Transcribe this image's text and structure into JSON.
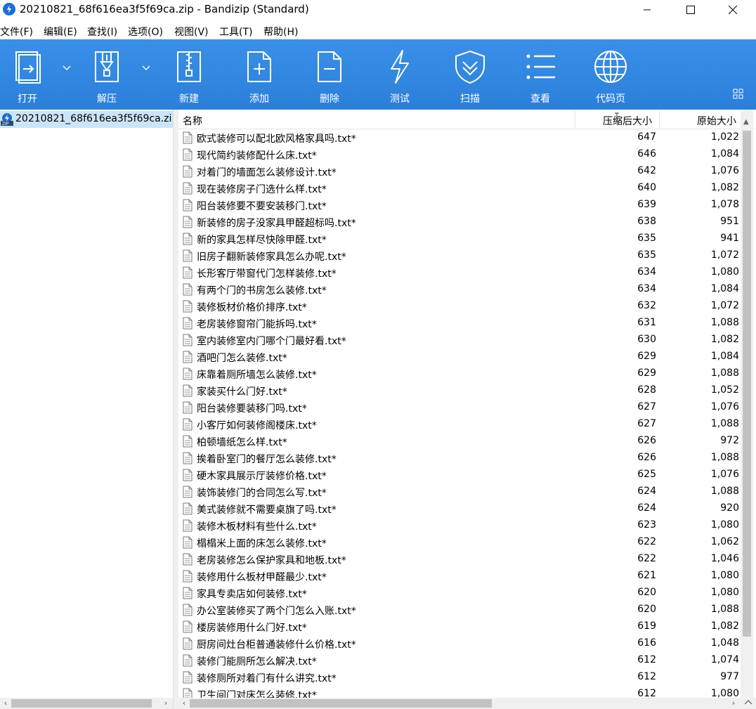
{
  "window": {
    "title": "20210821_68f616ea3f5f69ca.zip - Bandizip (Standard)"
  },
  "menu": [
    "文件(F)",
    "编辑(E)",
    "查找(I)",
    "选项(O)",
    "视图(V)",
    "工具(T)",
    "帮助(H)"
  ],
  "toolbar": {
    "open": "打开",
    "extract": "解压",
    "new": "新建",
    "add": "添加",
    "delete": "删除",
    "test": "测试",
    "scan": "扫描",
    "view": "查看",
    "codepage": "代码页"
  },
  "tree": {
    "archive": "20210821_68f616ea3f5f69ca.zi"
  },
  "columns": {
    "name": "名称",
    "compressed": "压缩后大小",
    "original": "原始大小"
  },
  "files": [
    {
      "name": "欧式装修可以配北欧风格家具吗.txt*",
      "compressed": "647",
      "original": "1,022"
    },
    {
      "name": "现代简约装修配什么床.txt*",
      "compressed": "646",
      "original": "1,084"
    },
    {
      "name": "对着门的墙面怎么装修设计.txt*",
      "compressed": "642",
      "original": "1,076"
    },
    {
      "name": "现在装修房子门选什么样.txt*",
      "compressed": "640",
      "original": "1,082"
    },
    {
      "name": "阳台装修要不要安装移门.txt*",
      "compressed": "639",
      "original": "1,078"
    },
    {
      "name": "新装修的房子没家具甲醛超标吗.txt*",
      "compressed": "638",
      "original": "951"
    },
    {
      "name": "新的家具怎样尽快除甲醛.txt*",
      "compressed": "635",
      "original": "941"
    },
    {
      "name": "旧房子翻新装修家具怎么办呢.txt*",
      "compressed": "635",
      "original": "1,072"
    },
    {
      "name": "长形客厅带窗代门怎样装修.txt*",
      "compressed": "634",
      "original": "1,080"
    },
    {
      "name": "有两个门的书房怎么装修.txt*",
      "compressed": "634",
      "original": "1,084"
    },
    {
      "name": "装修板材价格价排序.txt*",
      "compressed": "632",
      "original": "1,072"
    },
    {
      "name": "老房装修窗帘门能拆吗.txt*",
      "compressed": "631",
      "original": "1,088"
    },
    {
      "name": "室内装修室内门哪个门最好看.txt*",
      "compressed": "630",
      "original": "1,082"
    },
    {
      "name": "酒吧门怎么装修.txt*",
      "compressed": "629",
      "original": "1,084"
    },
    {
      "name": "床靠着厕所墙怎么装修.txt*",
      "compressed": "629",
      "original": "1,088"
    },
    {
      "name": "家装买什么门好.txt*",
      "compressed": "628",
      "original": "1,052"
    },
    {
      "name": "阳台装修要装移门吗.txt*",
      "compressed": "627",
      "original": "1,076"
    },
    {
      "name": "小客厅如何装修阁楼床.txt*",
      "compressed": "627",
      "original": "1,088"
    },
    {
      "name": "柏顿墙纸怎么样.txt*",
      "compressed": "626",
      "original": "972"
    },
    {
      "name": "挨着卧室门的餐厅怎么装修.txt*",
      "compressed": "626",
      "original": "1,088"
    },
    {
      "name": "硬木家具展示厅装修价格.txt*",
      "compressed": "625",
      "original": "1,076"
    },
    {
      "name": "装饰装修门的合同怎么写.txt*",
      "compressed": "624",
      "original": "1,088"
    },
    {
      "name": "美式装修就不需要桌旗了吗.txt*",
      "compressed": "624",
      "original": "920"
    },
    {
      "name": "装修木板材料有些什么.txt*",
      "compressed": "623",
      "original": "1,080"
    },
    {
      "name": "榻榻米上面的床怎么装修.txt*",
      "compressed": "622",
      "original": "1,062"
    },
    {
      "name": "老房装修怎么保护家具和地板.txt*",
      "compressed": "622",
      "original": "1,046"
    },
    {
      "name": "装修用什么板材甲醛最少.txt*",
      "compressed": "621",
      "original": "1,080"
    },
    {
      "name": "家具专卖店如何装修.txt*",
      "compressed": "620",
      "original": "1,080"
    },
    {
      "name": "办公室装修买了两个门怎么入账.txt*",
      "compressed": "620",
      "original": "1,088"
    },
    {
      "name": "楼房装修用什么门好.txt*",
      "compressed": "619",
      "original": "1,082"
    },
    {
      "name": "厨房间灶台柜普通装修什么价格.txt*",
      "compressed": "616",
      "original": "1,048"
    },
    {
      "name": "装修门能厕所怎么解决.txt*",
      "compressed": "612",
      "original": "1,074"
    },
    {
      "name": "装修厕所对着门有什么讲究.txt*",
      "compressed": "612",
      "original": "977"
    },
    {
      "name": "卫生间门对床怎么装修.txt*",
      "compressed": "612",
      "original": "1,080"
    }
  ]
}
